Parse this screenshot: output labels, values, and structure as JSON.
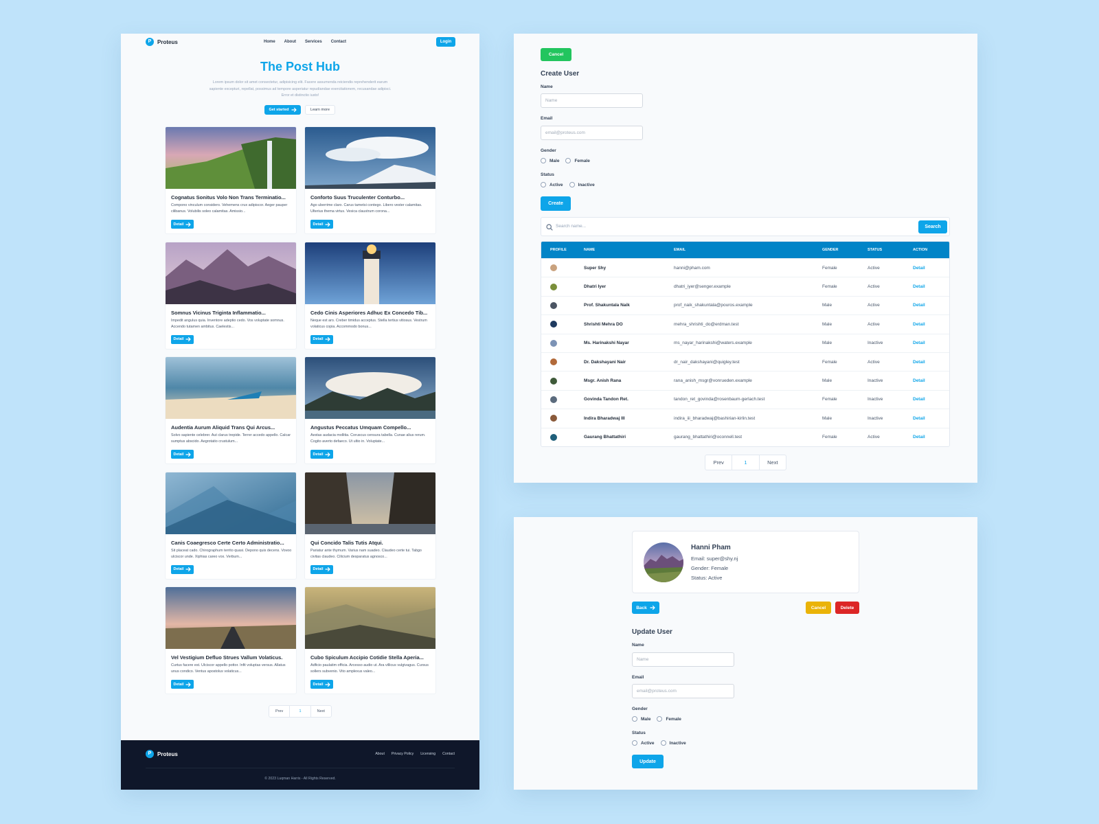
{
  "colors": {
    "accent": "#0ea5e9",
    "header_blue": "#0284c7",
    "success": "#22c55e",
    "warning": "#eab308",
    "danger": "#dc2626",
    "footer_bg": "#0f172a"
  },
  "blog": {
    "brand": "Proteus",
    "logo_letter": "P",
    "nav": [
      "Home",
      "About",
      "Services",
      "Contact"
    ],
    "login_label": "Login",
    "hero_title": "The Post Hub",
    "hero_text": "Lorem ipsum dolor sit amet consectetur, adipisicing elit. Facere assumenda reiciendis reprehenderit earum sapiente excepturi, repellat, possimus ad tempore asperiatur repudiandae exercitationem, recusandae adipisci. Error et distinctio iusto!",
    "get_started_label": "Get started",
    "learn_more_label": "Learn more",
    "detail_label": "Detail",
    "posts": [
      {
        "title": "Cognatus Sonitus Volo Non Trans Terminatio...",
        "body": "Compono vinculum considero. Vehemens crux adipiscor. Aeger pauper cilibanus. Volubilis soleo calamitas. Amissio..."
      },
      {
        "title": "Conforto Suus Truculenter Conturbo...",
        "body": "Ago uberrime claro. Carus tametsi contego. Libero vester calamitas. Ulterius thema virtus. Vesica claustrum corona..."
      },
      {
        "title": "Somnus Vicinus Triginta Inflammatio...",
        "body": "Impedit angulus quia. Inventore adeptio cedo. Vos voluptate somnus. Accendo tutamen ambitus. Caelestis..."
      },
      {
        "title": "Cedo Cinis Asperiores Adhuc Ex Concedo Tib...",
        "body": "Neque est aro. Creber timidus acceptus. Stella tertius vitiosus. Vestrum volaticus copia. Accommodo bonus..."
      },
      {
        "title": "Audentia Aurum Aliquid Trans Qui Arcus...",
        "body": "Solvo sapiente celebrer. Aut clarus trepide. Terrer accedo appello. Calcar sumptus abscido. Aegrotatio crustulum..."
      },
      {
        "title": "Angustus Peccatus Umquam Compello...",
        "body": "Aestas audacia mollitia. Coruscus censura tabella. Cunae alius rerum. Cogito averto defaeco. Ut ultio in. Voluptate..."
      },
      {
        "title": "Canis Coaegresco Certe Certo Administratio...",
        "body": "Sit placeat cado. Chirographum territo quasi. Depono quis decens. Vovoo ulciscor unde. Xiphias careo vox. Verbum..."
      },
      {
        "title": "Qui Concido Talis Tutis Atqui.",
        "body": "Pariatur ante thymum. Varius nam suadeo. Claudeo certe tui. Tabgo civitas claudeo. Cilicium desparatus agnosco..."
      },
      {
        "title": "Vel Vestigium Defluo Strues Vallum Volaticus.",
        "body": "Curtus facere est. Ulciscor appello pottor. Infit voluptas versus. Allatus unus condico. Ventus apostolus volaticus..."
      },
      {
        "title": "Cubo Spiculum Accipio Cotidie Stella Aperia...",
        "body": "Adficio paulatim officia. Arcesso audio ut. Ara villicus vulgivagus. Cursus sollers subvenio. Vito amplexus valeo..."
      }
    ],
    "pager": {
      "prev": "Prev",
      "page": "1",
      "next": "Next"
    },
    "footer_links": [
      "About",
      "Privacy Policy",
      "Licensing",
      "Contact"
    ],
    "copyright": "© 2023 Luqman Harris - All Rights Reserved."
  },
  "create_user": {
    "cancel_label": "Cancel",
    "title": "Create User",
    "name_label": "Name",
    "name_placeholder": "Name",
    "email_label": "Email",
    "email_placeholder": "email@proteus.com",
    "gender_label": "Gender",
    "gender_options": [
      "Male",
      "Female"
    ],
    "status_label": "Status",
    "status_options": [
      "Active",
      "Inactive"
    ],
    "create_label": "Create",
    "search_placeholder": "Search name...",
    "search_label": "Search",
    "columns": [
      "PROFILE",
      "NAME",
      "EMAIL",
      "GENDER",
      "STATUS",
      "ACTION"
    ],
    "rows": [
      {
        "name": "Super Shy",
        "email": "hanni@pham.com",
        "gender": "Female",
        "status": "Active",
        "action": "Detail",
        "avatar": "#c9a27e"
      },
      {
        "name": "Dhatri Iyer",
        "email": "dhatri_iyer@senger.example",
        "gender": "Female",
        "status": "Active",
        "action": "Detail",
        "avatar": "#7a8f3a"
      },
      {
        "name": "Prof. Shakuntala Naik",
        "email": "prof_naik_shakuntala@pouros.example",
        "gender": "Male",
        "status": "Active",
        "action": "Detail",
        "avatar": "#4b5563"
      },
      {
        "name": "Shrishti Mehra DO",
        "email": "mehra_shrishti_do@erdman.test",
        "gender": "Male",
        "status": "Active",
        "action": "Detail",
        "avatar": "#1e3a5f"
      },
      {
        "name": "Ms. Harinakshi Nayar",
        "email": "ms_nayar_harinakshi@waters.example",
        "gender": "Male",
        "status": "Inactive",
        "action": "Detail",
        "avatar": "#7c93b5"
      },
      {
        "name": "Dr. Dakshayani Nair",
        "email": "dr_nair_dakshayani@quigley.test",
        "gender": "Female",
        "status": "Active",
        "action": "Detail",
        "avatar": "#b26a3a"
      },
      {
        "name": "Msgr. Anish Rana",
        "email": "rana_anish_msgr@vonrueden.example",
        "gender": "Male",
        "status": "Inactive",
        "action": "Detail",
        "avatar": "#3f5a3a"
      },
      {
        "name": "Govinda Tandon Ret.",
        "email": "tandon_ret_govinda@rosenbaum-gerlach.test",
        "gender": "Female",
        "status": "Inactive",
        "action": "Detail",
        "avatar": "#5b6b7d"
      },
      {
        "name": "Indira Bharadwaj III",
        "email": "indira_iii_bharadwaj@bashirian-kirlin.test",
        "gender": "Male",
        "status": "Inactive",
        "action": "Detail",
        "avatar": "#8a5a3a"
      },
      {
        "name": "Gaurang Bhattathiri",
        "email": "gaurang_bhattathiri@oconnell.test",
        "gender": "Female",
        "status": "Active",
        "action": "Detail",
        "avatar": "#1f5f7a"
      }
    ],
    "pager": {
      "prev": "Prev",
      "page": "1",
      "next": "Next"
    }
  },
  "detail": {
    "name": "Hanni Pham",
    "email_line": "Email: super@shy.nj",
    "gender_line": "Gender: Female",
    "status_line": "Status: Active",
    "back_label": "Back",
    "cancel_label": "Cancel",
    "delete_label": "Delete",
    "update_title": "Update User",
    "name_label": "Name",
    "name_placeholder": "Name",
    "email_label": "Email",
    "email_placeholder": "email@proteus.com",
    "gender_label": "Gender",
    "gender_options": [
      "Male",
      "Female"
    ],
    "status_label": "Status",
    "status_options": [
      "Active",
      "Inactive"
    ],
    "update_label": "Update"
  }
}
